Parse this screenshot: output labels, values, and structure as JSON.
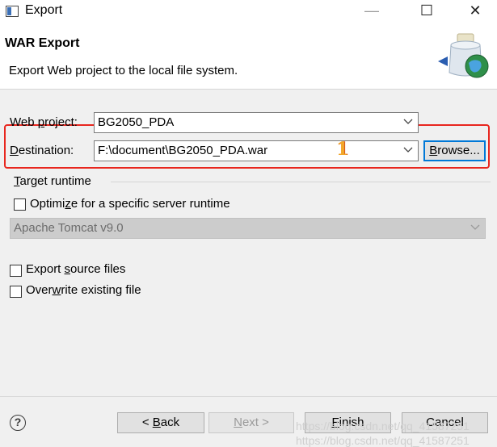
{
  "window": {
    "title": "Export",
    "minimize": "—",
    "maximize": "☐",
    "close": "✕"
  },
  "header": {
    "title": "WAR Export",
    "description": "Export Web project to the local file system."
  },
  "form": {
    "web_project_label_pre": "Web ",
    "web_project_label_ul": "p",
    "web_project_label_post": "roject:",
    "web_project_value": "BG2050_PDA",
    "destination_label_ul": "D",
    "destination_label_post": "estination:",
    "destination_value": "F:\\document\\BG2050_PDA.war",
    "annotation_number": "1",
    "browse_ul": "B",
    "browse_post": "rowse..."
  },
  "target_runtime": {
    "label_ul": "T",
    "label_post": "arget runtime",
    "optimize_pre": "Optimi",
    "optimize_ul": "z",
    "optimize_post": "e for a specific server runtime",
    "optimize_checked": false,
    "runtime_value": "Apache Tomcat v9.0"
  },
  "options": {
    "export_source_pre": "Export ",
    "export_source_ul": "s",
    "export_source_post": "ource files",
    "export_source_checked": false,
    "overwrite_pre": "Over",
    "overwrite_ul": "w",
    "overwrite_post": "rite existing file",
    "overwrite_checked": false
  },
  "footer": {
    "help": "?",
    "back_pre": "< ",
    "back_ul": "B",
    "back_post": "ack",
    "next_ul": "N",
    "next_post": "ext >",
    "finish_ul": "F",
    "finish_post": "inish",
    "cancel": "Cancel"
  },
  "watermark": {
    "line1": "https://blog.csdn.net/qq_41587251",
    "line2": "https://blog.csdn.net/qq_41587251"
  },
  "colors": {
    "highlight": "#e8261e",
    "default_button_border": "#0078d7",
    "annotation": "#f2a72b"
  }
}
